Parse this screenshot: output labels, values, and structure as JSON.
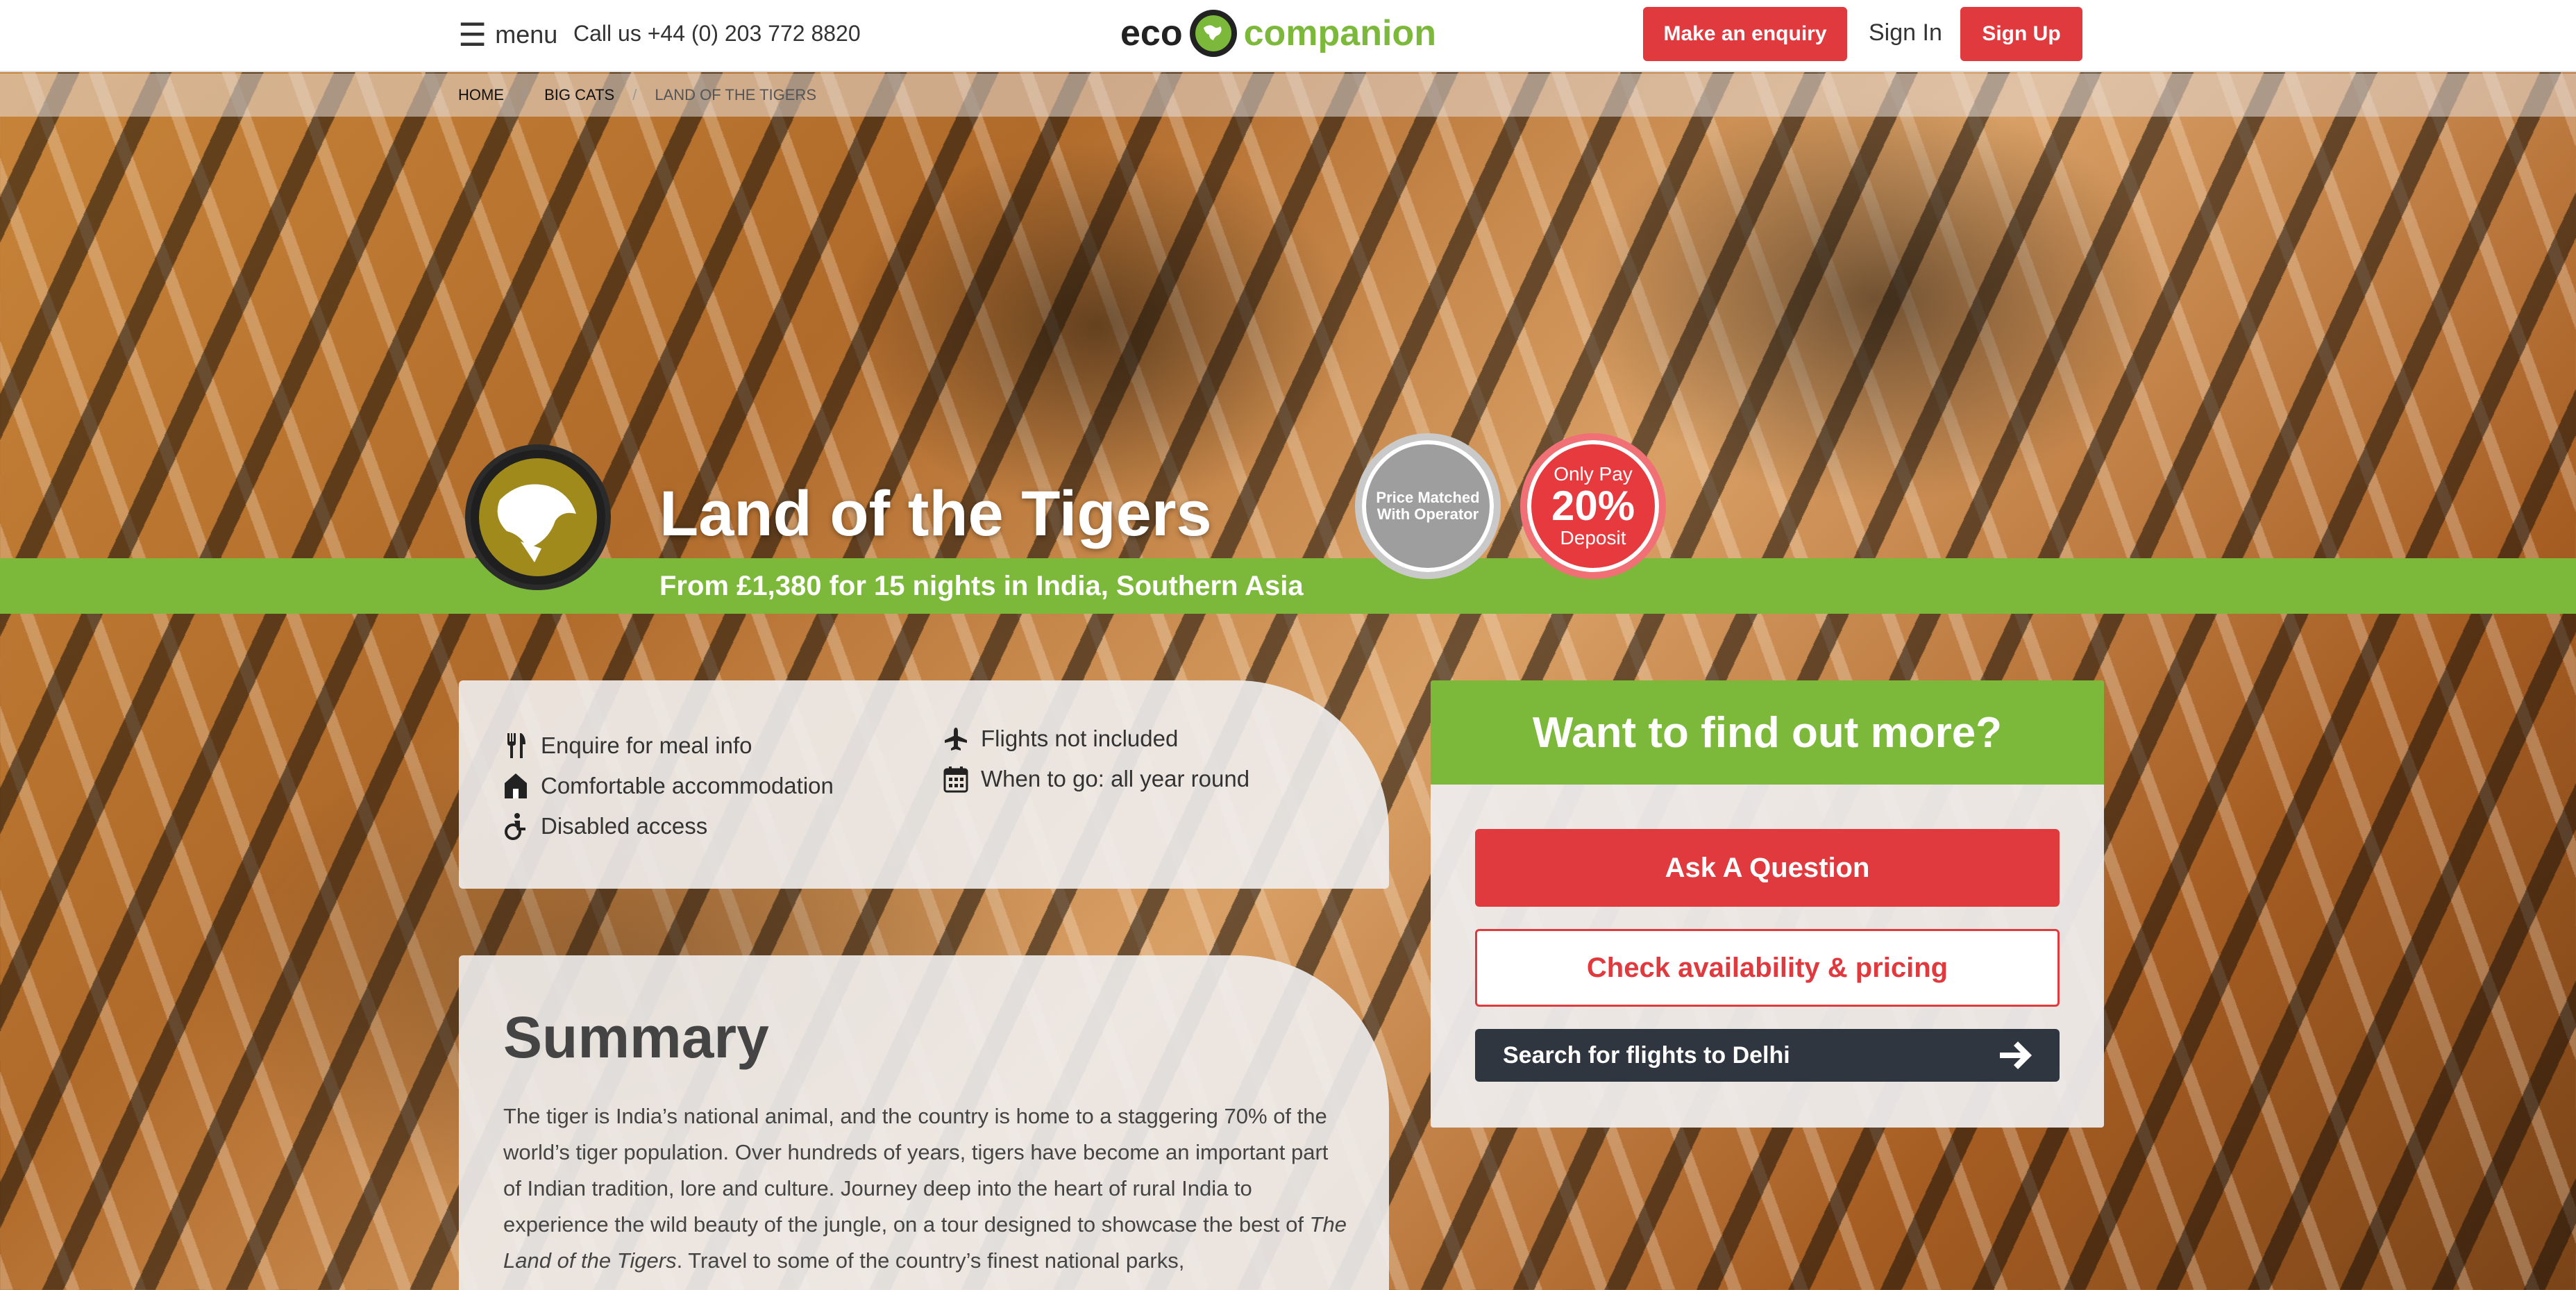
{
  "header": {
    "menu_label": "menu",
    "phone": "Call us +44 (0) 203 772 8820",
    "logo_left": "eco",
    "logo_right": "companion",
    "enquiry_label": "Make an enquiry",
    "signin_label": "Sign In",
    "signup_label": "Sign Up"
  },
  "breadcrumb": {
    "items": [
      "HOME",
      "BIG CATS",
      "LAND OF THE TIGERS"
    ]
  },
  "hero": {
    "title": "Land of the Tigers",
    "subtitle": "From £1,380 for 15 nights in India, Southern Asia",
    "seal_price_line1": "Price Matched",
    "seal_price_line2": "With Operator",
    "seal_deposit_line1": "Only Pay",
    "seal_deposit_line2": "20%",
    "seal_deposit_line3": "Deposit"
  },
  "features": {
    "items": [
      {
        "icon": "cutlery-icon",
        "label": "Enquire for meal info"
      },
      {
        "icon": "house-icon",
        "label": "Comfortable accommodation"
      },
      {
        "icon": "wheelchair-icon",
        "label": "Disabled access"
      },
      {
        "icon": "plane-icon",
        "label": "Flights not included"
      },
      {
        "icon": "calendar-icon",
        "label": "When to go: all year round"
      }
    ]
  },
  "summary": {
    "heading": "Summary",
    "text_before": "The tiger is India’s national animal, and the country is home to a staggering 70% of the world’s tiger population. Over hundreds of years, tigers have become an important part of Indian tradition, lore and culture. Journey deep into the heart of rural India to experience the wild beauty of the jungle, on a tour designed to showcase the best of ",
    "text_italic": "The Land of the Tigers",
    "text_after": ". Travel to some of the country’s finest national parks,"
  },
  "enquiry_panel": {
    "heading": "Want to find out more?",
    "ask_label": "Ask A Question",
    "check_label": "Check availability & pricing",
    "flights_label": "Search for flights to Delhi"
  },
  "colors": {
    "brand_green": "#7cb83a",
    "accent_red": "#e0393e",
    "dark_button": "#2f3640"
  }
}
